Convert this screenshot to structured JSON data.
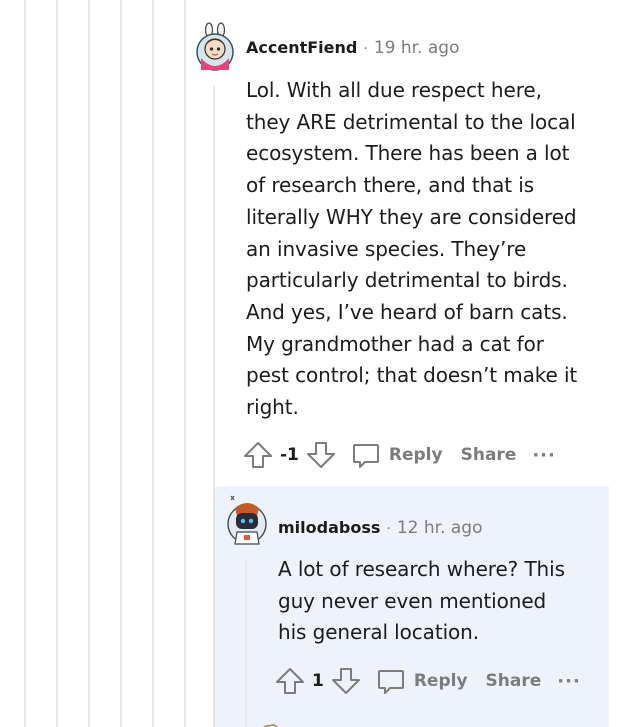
{
  "comments": [
    {
      "author": "AccentFiend",
      "separator": "·",
      "time": "19 hr. ago",
      "body": [
        "Lol. With all due respect here,",
        "they ARE detrimental to the local",
        "ecosystem. There has been a lot",
        "of research there, and that is",
        "literally WHY they are considered",
        "an invasive species. They’re",
        "particularly detrimental to birds.",
        "And yes, I’ve heard of barn cats.",
        "My grandmother had a cat for",
        "pest control; that doesn’t make it",
        "right."
      ],
      "score": "-1",
      "reply_label": "Reply",
      "share_label": "Share",
      "more_label": "···"
    },
    {
      "author": "milodaboss",
      "separator": "·",
      "time": "12 hr. ago",
      "body": [
        "A lot of research where? This",
        "guy never even mentioned",
        "his general location."
      ],
      "score": "1",
      "reply_label": "Reply",
      "share_label": "Share",
      "more_label": "···"
    }
  ],
  "icons": {
    "upvote": "upvote-arrow-icon",
    "downvote": "downvote-arrow-icon",
    "reply": "speech-bubble-icon",
    "more": "ellipsis-icon"
  },
  "colors": {
    "thread_line": "#e4e6e8",
    "reply_highlight": "#eef3fb",
    "meta_gray": "#7c7c7c",
    "text": "#1c1c1c"
  }
}
